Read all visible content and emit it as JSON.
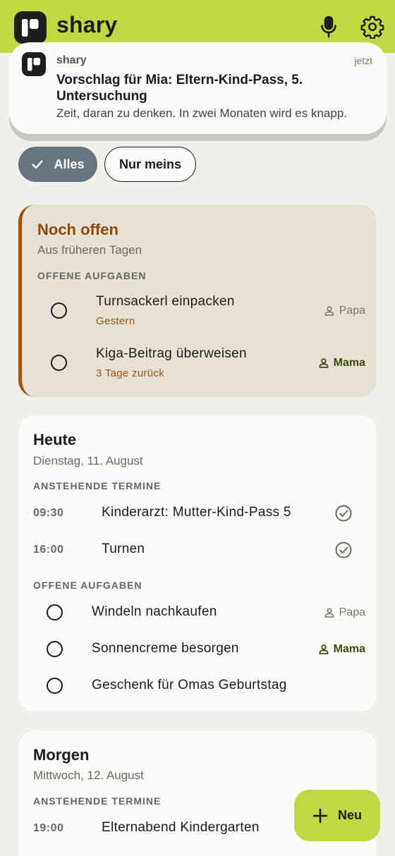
{
  "app": {
    "title": "shary"
  },
  "notification": {
    "app_name": "shary",
    "time": "jetzt",
    "title": "Vorschlag für Mia: Eltern-Kind-Pass, 5. Untersuchung",
    "body": "Zeit, daran zu denken. In zwei Monaten wird es knapp."
  },
  "filters": [
    {
      "label": "Alles",
      "selected": true
    },
    {
      "label": "Nur meins",
      "selected": false
    }
  ],
  "overdue": {
    "title": "Noch offen",
    "subtitle": "Aus früheren Tagen",
    "section": "OFFENE AUFGABEN",
    "tasks": [
      {
        "label": "Turnsackerl einpacken",
        "due": "Gestern",
        "assignee": "Papa"
      },
      {
        "label": "Kiga-Beitrag überweisen",
        "due": "3 Tage zurück",
        "assignee": "Mama"
      }
    ]
  },
  "today": {
    "title": "Heute",
    "subtitle": "Dienstag, 11. August",
    "events_section": "ANSTEHENDE TERMINE",
    "events": [
      {
        "time": "09:30",
        "label": "Kinderarzt: Mutter-Kind-Pass 5"
      },
      {
        "time": "16:00",
        "label": "Turnen"
      }
    ],
    "tasks_section": "OFFENE AUFGABEN",
    "tasks": [
      {
        "label": "Windeln nachkaufen",
        "assignee": "Papa"
      },
      {
        "label": "Sonnencreme besorgen",
        "assignee": "Mama"
      },
      {
        "label": "Geschenk für Omas Geburtstag",
        "assignee": ""
      }
    ]
  },
  "tomorrow": {
    "title": "Morgen",
    "subtitle": "Mittwoch, 12. August",
    "events_section": "ANSTEHENDE TERMINE",
    "events": [
      {
        "time": "19:00",
        "label": "Elternabend Kindergarten"
      }
    ]
  },
  "fab": {
    "label": "Neu"
  },
  "colors": {
    "brand": "#c1d743",
    "overdue_accent": "#a3540f",
    "chip_selected": "#687480",
    "mama_text": "#3f4a0f"
  },
  "icons": [
    "app-logo-icon",
    "mic-icon",
    "gear-icon",
    "check-icon",
    "person-icon",
    "check-circle-icon",
    "plus-icon"
  ]
}
